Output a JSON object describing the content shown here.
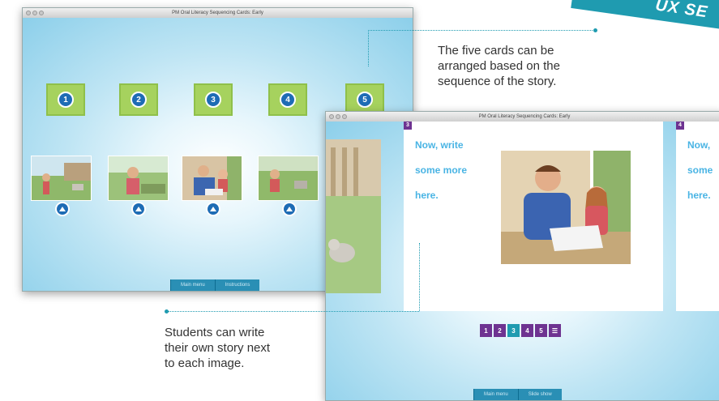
{
  "banner": {
    "text": "UX SE"
  },
  "window1": {
    "title": "PM Oral Literacy Sequencing Cards: Early",
    "slots": [
      "1",
      "2",
      "3",
      "4",
      "5"
    ],
    "buttons": [
      "Main menu",
      "Instructions"
    ]
  },
  "window2": {
    "title": "PM Oral Literacy Sequencing Cards: Early",
    "card_left_number": "3",
    "card_left_text": [
      "Now, write",
      "some more",
      "here."
    ],
    "card_right_number": "4",
    "card_right_text": [
      "Now,",
      "some",
      "here."
    ],
    "pager": [
      "1",
      "2",
      "3",
      "4",
      "5",
      "☰"
    ],
    "pager_current": "3",
    "buttons": [
      "Main menu",
      "Slide show"
    ]
  },
  "annotations": {
    "top": [
      "The five cards can be",
      "arranged based on the",
      "sequence of the story."
    ],
    "bottom": [
      "Students can write",
      "their own story next",
      "to each image."
    ]
  },
  "colors": {
    "accent": "#1f9bb0",
    "slot_green": "#a6d25e",
    "number_blue": "#1e6cb5",
    "card_purple": "#6e3391",
    "text_blue": "#49b4e4"
  }
}
